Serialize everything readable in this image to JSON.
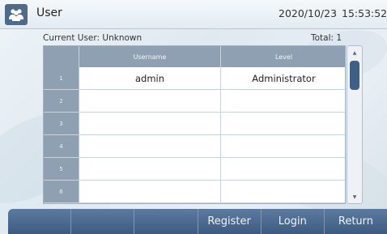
{
  "header": {
    "icon": "users-icon",
    "title": "User",
    "date": "2020/10/23",
    "time": "15:53:52"
  },
  "info": {
    "current_user": "Current User:  Unknown",
    "total": "Total:  1"
  },
  "table": {
    "columns": [
      "",
      "Username",
      "Level"
    ],
    "rows": [
      {
        "index": "1",
        "username": "admin",
        "level": "Administrator"
      },
      {
        "index": "2",
        "username": "",
        "level": ""
      },
      {
        "index": "3",
        "username": "",
        "level": ""
      },
      {
        "index": "4",
        "username": "",
        "level": ""
      },
      {
        "index": "5",
        "username": "",
        "level": ""
      },
      {
        "index": "6",
        "username": "",
        "level": ""
      }
    ]
  },
  "toolbar": {
    "buttons": [
      "",
      "",
      "",
      "Register",
      "Login",
      "Return"
    ]
  },
  "colors": {
    "accent": "#3d5a80",
    "header_bg": "#8ea0b2"
  }
}
